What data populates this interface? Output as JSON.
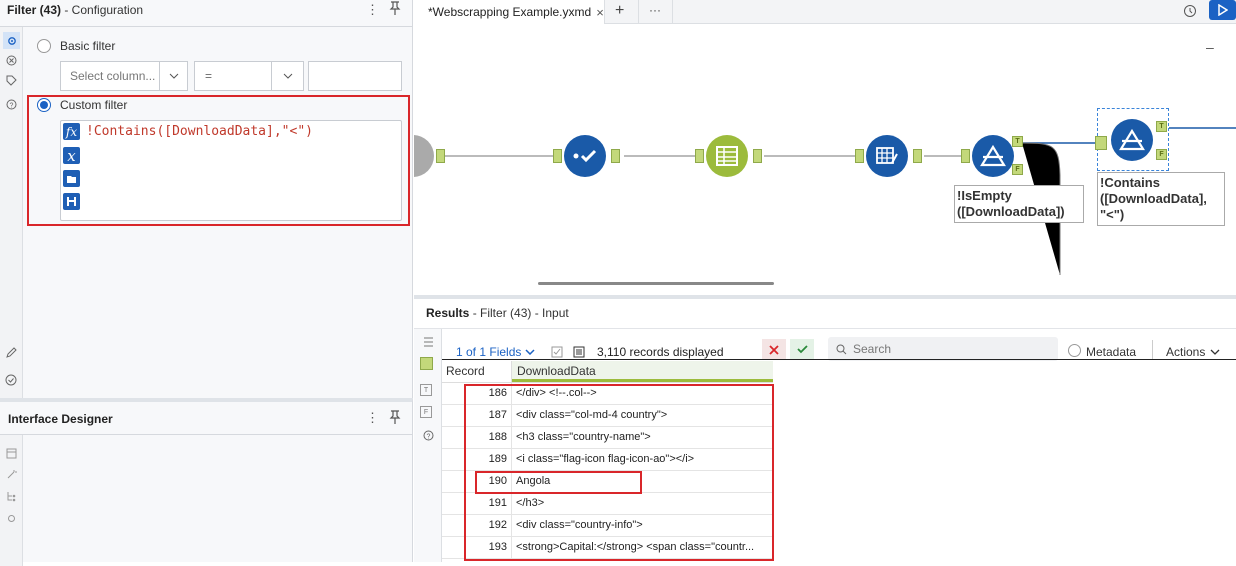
{
  "config": {
    "title_main": "Filter (43)",
    "title_sub": " - Configuration",
    "basic_filter": "Basic filter",
    "select_column_placeholder": "Select column...",
    "operator": "=",
    "custom_filter": "Custom filter",
    "expression": "!Contains([DownloadData],\"<\")"
  },
  "interface_designer": {
    "title": "Interface Designer"
  },
  "tabs": {
    "active_tab": "*Webscrapping Example.yxmd",
    "close_glyph": "×",
    "add_glyph": "+",
    "more_glyph": "···"
  },
  "canvas": {
    "tool1_annotation_line1": "!IsEmpty",
    "tool1_annotation_line2": "([DownloadData])",
    "tool2_annotation_line1": "!Contains",
    "tool2_annotation_line2": "([DownloadData],",
    "tool2_annotation_line3": "\"<\")",
    "port_t": "T",
    "port_f": "F",
    "zoom_minus": "–"
  },
  "results": {
    "title_main": "Results",
    "title_sub": " - Filter (43) - Input",
    "fields_text": "1 of 1 Fields",
    "records_text": "3,110 records displayed",
    "search_placeholder": "Search",
    "metadata_label": "Metadata",
    "actions_label": "Actions",
    "col_record": "Record",
    "col_data": "DownloadData",
    "rows": [
      {
        "record": "186",
        "data": "</div> <!--.col-->"
      },
      {
        "record": "187",
        "data": "<div class=\"col-md-4 country\">"
      },
      {
        "record": "188",
        "data": "<h3 class=\"country-name\">"
      },
      {
        "record": "189",
        "data": "<i class=\"flag-icon flag-icon-ao\"></i>"
      },
      {
        "record": "190",
        "data": "Angola"
      },
      {
        "record": "191",
        "data": "</h3>"
      },
      {
        "record": "192",
        "data": "<div class=\"country-info\">"
      },
      {
        "record": "193",
        "data": "<strong>Capital:</strong> <span class=\"countr..."
      }
    ]
  },
  "colors": {
    "accent": "#1b62c4",
    "node_blue": "#1a5aa8",
    "node_green": "#9cbb3c",
    "highlight_red": "#d9262a"
  }
}
